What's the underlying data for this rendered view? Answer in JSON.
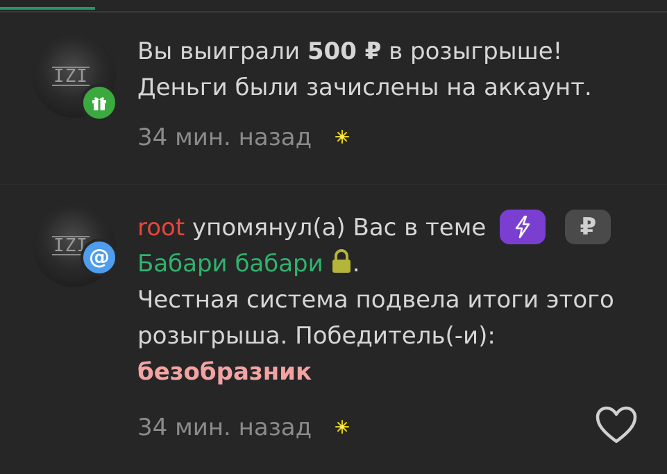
{
  "notifications": [
    {
      "type": "prize",
      "badge_icon": "gift-icon",
      "badge_color": "#3aaa3f",
      "line1_before": "Вы выиграли ",
      "amount": "500 ₽",
      "line1_after": " в розыгрыше!",
      "line2": "Деньги были зачислены на аккаунт.",
      "time": "34 мин. назад"
    },
    {
      "type": "mention",
      "badge_icon": "at-icon",
      "badge_color": "#4f9ded",
      "badge_text": "@",
      "user": "root",
      "mention_text": " упомянул(а) Вас в теме",
      "ruble_pill": "₽",
      "topic": "Бабари бабари",
      "topic_suffix": ".",
      "body1": "Честная система подвела итоги этого",
      "body2": "розыгрыша. Победитель(-и):",
      "winner": "безобразник",
      "time": "34 мин. назад"
    }
  ],
  "colors": {
    "background": "#262626",
    "accent_green": "#1f9a63",
    "user_red": "#e8453c",
    "topic_green": "#2fb36e",
    "winner_pink": "#f3a3a3"
  }
}
